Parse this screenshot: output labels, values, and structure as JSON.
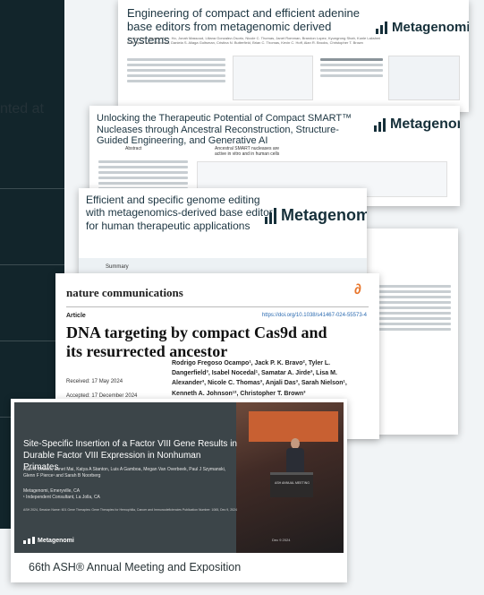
{
  "side": {
    "partial_text": "nted at"
  },
  "card1": {
    "title": "Engineering of compact and efficient adenine base editors from metagenomic derived systems",
    "authors": "Jin Hee Yan, Jasmine M. L. Ho, Jonah Massoud, Liliana Gonzalez-Osorio, Nicole C. Thomas, Janet Romman, Brandon Lopez, Kyungrong Shah, Kunle Lakshmi Radhapati, Isabel Nocedal, Daniela S. Aliaga Goltsman, Cristina N. Butterfield, Brian C. Thomas, Kevin C. Hoff, Alan R. Brooks, Christopher T. Brown",
    "logo": "Metagenomi"
  },
  "card2": {
    "title": "Unlocking the Therapeutic Potential of Compact SMART™ Nucleases through Ancestral Reconstruction, Structure-Guided Engineering, and Generative AI",
    "logo": "Metagenomi",
    "abstract": "Abstract",
    "ancestral": "Ancestral SMART nucleases are active in vitro and in human cells"
  },
  "card3": {
    "title": "Efficient and specific genome editing with metagenomics-derived base editor for human therapeutic applications",
    "logo": "Metagenomi",
    "summary": "Summary"
  },
  "nature": {
    "journal": "nature communications",
    "article_label": "Article",
    "doi": "https://doi.org/10.1038/s41467-024-55573-4",
    "headline": "DNA targeting by compact Cas9d and its resurrected ancestor",
    "received": "Received: 17 May 2024",
    "accepted": "Accepted: 17 December 2024",
    "authors": "Rodrigo Fregoso Ocampo¹, Jack P. K. Bravo², Tyler L. Dangerfield³, Isabel Nocedal¹, Samatar A. Jirde³, Lisa M. Alexander³, Nicole C. Thomas³, Anjali Das³, Sarah Nielson¹, Kenneth A. Johnson¹², Christopher T. Brown³"
  },
  "pres": {
    "slide_title": "Site-Specific Insertion of a Factor VIII Gene Results in Durable Factor VIII Expression in Nonhuman Primates",
    "slide_authors": "Alan R Brooks, Janet Mai, Katya A Stanton, Luis A Gamboa, Megan Van Overbeek, Paul J Szymanski, Glenn F Pierce¹ and Sarah B Noorberg",
    "slide_affiliation": "Metagenomi, Emeryville, CA\n¹ Independent Consultant, La Jolla, CA",
    "slide_meta": "ASH 2024, Session Name: 601 Gene Therapies: Gene Therapies for Hemophilia, Cancer and Immunodeficiencies Publication Number: 1065, Dec 9, 2024",
    "slide_logo": "Metagenomi",
    "slide_date": "Dec 9 2024",
    "podium_label": "ASH ANNUAL MEETING",
    "caption": "66th ASH® Annual Meeting and Exposition"
  }
}
